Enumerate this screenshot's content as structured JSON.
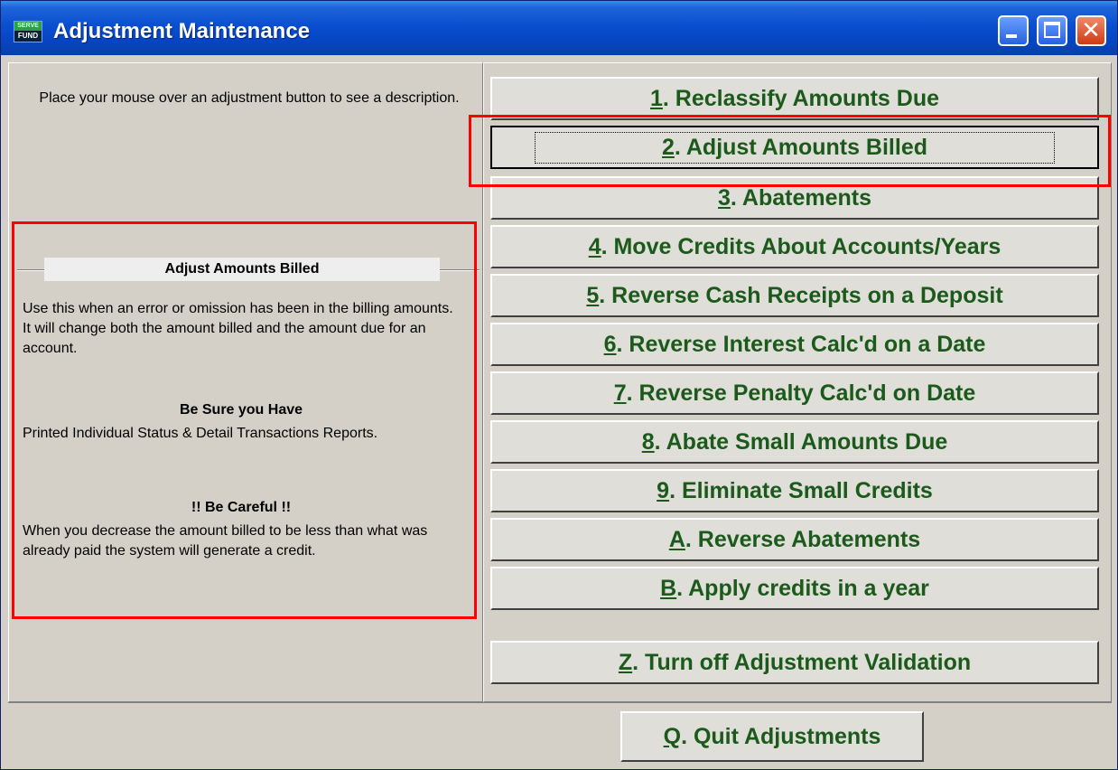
{
  "window": {
    "title": "Adjustment Maintenance",
    "app_icon_top": "SERVE",
    "app_icon_bottom": "FUND"
  },
  "left": {
    "hint": "Place your mouse over an adjustment button to see a description.",
    "group_title": "Adjust Amounts Billed",
    "description": "Use this when an error or omission has been in the billing amounts.  It will change both the amount billed and the amount due for an account.",
    "be_sure_heading": "Be Sure you Have",
    "be_sure_text": "Printed Individual Status & Detail Transactions Reports.",
    "careful_heading": "!! Be Careful !!",
    "careful_text": "When you decrease the amount billed to be less than what was already paid the system will generate a credit."
  },
  "buttons": [
    {
      "key": "1",
      "rest": ".  Reclassify Amounts Due"
    },
    {
      "key": "2",
      "rest": ". Adjust Amounts Billed"
    },
    {
      "key": "3",
      "rest": ". Abatements"
    },
    {
      "key": "4",
      "rest": ". Move Credits About Accounts/Years"
    },
    {
      "key": "5",
      "rest": ". Reverse Cash Receipts on a Deposit"
    },
    {
      "key": "6",
      "rest": ". Reverse Interest Calc'd on a Date"
    },
    {
      "key": "7",
      "rest": ". Reverse Penalty Calc'd on Date"
    },
    {
      "key": "8",
      "rest": ". Abate Small Amounts Due"
    },
    {
      "key": "9",
      "rest": ". Eliminate Small Credits"
    },
    {
      "key": "A",
      "rest": ". Reverse Abatements"
    },
    {
      "key": "B",
      "rest": ". Apply credits in a year"
    },
    {
      "key": "Z",
      "rest": ". Turn off Adjustment Validation"
    },
    {
      "key": "Q",
      "rest": ".  Quit Adjustments"
    }
  ],
  "colors": {
    "button_text": "#1b5a1b",
    "highlight": "#ff0000",
    "title_bar": "#0a4fd0"
  }
}
